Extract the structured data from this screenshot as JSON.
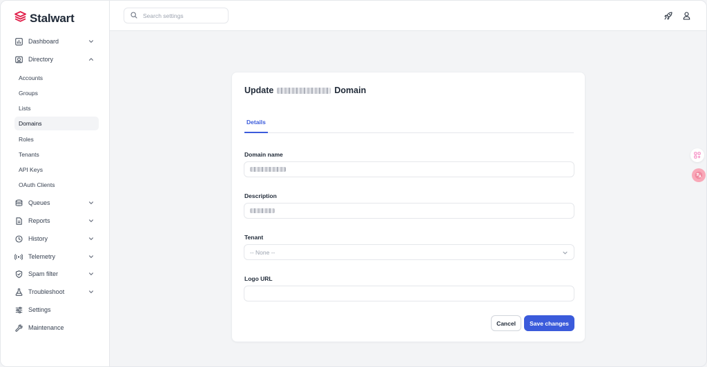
{
  "brand": {
    "name": "Stalwart",
    "color": "#e11d48"
  },
  "search": {
    "placeholder": "Search settings"
  },
  "sidebar": {
    "items": [
      {
        "label": "Dashboard",
        "icon": "dashboard-icon",
        "expanded": false
      },
      {
        "label": "Directory",
        "icon": "directory-icon",
        "expanded": true
      },
      {
        "label": "Queues",
        "icon": "queues-icon",
        "expanded": false
      },
      {
        "label": "Reports",
        "icon": "reports-icon",
        "expanded": false
      },
      {
        "label": "History",
        "icon": "history-icon",
        "expanded": false
      },
      {
        "label": "Telemetry",
        "icon": "telemetry-icon",
        "expanded": false
      },
      {
        "label": "Spam filter",
        "icon": "shield-icon",
        "expanded": false
      },
      {
        "label": "Troubleshoot",
        "icon": "flask-icon",
        "expanded": false
      },
      {
        "label": "Settings",
        "icon": "sliders-icon"
      },
      {
        "label": "Maintenance",
        "icon": "wrench-icon"
      }
    ],
    "directory_subitems": [
      {
        "label": "Accounts"
      },
      {
        "label": "Groups"
      },
      {
        "label": "Lists"
      },
      {
        "label": "Domains",
        "active": true
      },
      {
        "label": "Roles"
      },
      {
        "label": "Tenants"
      },
      {
        "label": "API Keys"
      },
      {
        "label": "OAuth Clients"
      }
    ]
  },
  "form": {
    "title_prefix": "Update",
    "title_suffix": "Domain",
    "tabs": [
      {
        "label": "Details",
        "active": true
      }
    ],
    "fields": {
      "domain_name": {
        "label": "Domain name"
      },
      "description": {
        "label": "Description"
      },
      "tenant": {
        "label": "Tenant",
        "value": "-- None --"
      },
      "logo_url": {
        "label": "Logo URL",
        "value": ""
      }
    },
    "buttons": {
      "cancel": "Cancel",
      "save": "Save changes"
    }
  },
  "colors": {
    "accent": "#3b5bdb",
    "brand": "#e11d48"
  }
}
